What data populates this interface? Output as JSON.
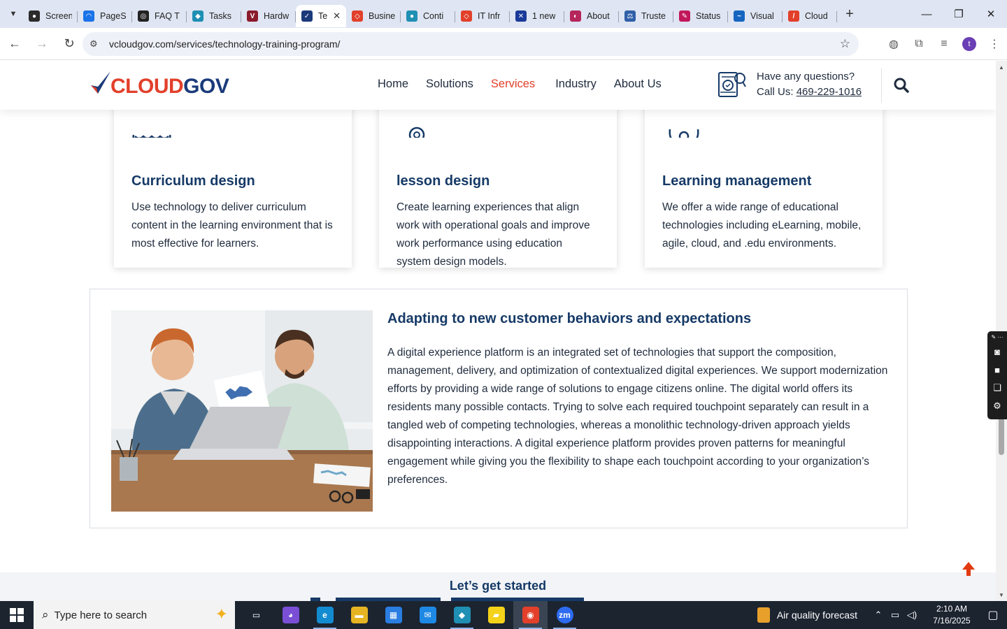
{
  "browser": {
    "tabs": [
      {
        "title": "Screen",
        "fav_color": "#2b2b2b",
        "fav_glyph": "●"
      },
      {
        "title": "PageS",
        "fav_color": "#1a73e8",
        "fav_glyph": "◠"
      },
      {
        "title": "FAQ T",
        "fav_color": "#222222",
        "fav_glyph": "◎"
      },
      {
        "title": "Tasks",
        "fav_color": "#1f8fb3",
        "fav_glyph": "◆"
      },
      {
        "title": "Hardw",
        "fav_color": "#8b1a2b",
        "fav_glyph": "V"
      },
      {
        "title": "Te",
        "fav_color": "#1a3a7a",
        "fav_glyph": "✓",
        "active": true
      },
      {
        "title": "Busine",
        "fav_color": "#e2402b",
        "fav_glyph": "◇"
      },
      {
        "title": "Conti",
        "fav_color": "#1f8fb3",
        "fav_glyph": "●"
      },
      {
        "title": "IT Infr",
        "fav_color": "#e2402b",
        "fav_glyph": "◇"
      },
      {
        "title": "1 new",
        "fav_color": "#1a3a9a",
        "fav_glyph": "✕"
      },
      {
        "title": "About",
        "fav_color": "#b5265a",
        "fav_glyph": "◐"
      },
      {
        "title": "Truste",
        "fav_color": "#2f5fa8",
        "fav_glyph": "⚖"
      },
      {
        "title": "Status",
        "fav_color": "#c2185b",
        "fav_glyph": "✎"
      },
      {
        "title": "Visual",
        "fav_color": "#1565c0",
        "fav_glyph": "~"
      },
      {
        "title": "Cloud",
        "fav_color": "#e2402b",
        "fav_glyph": "/"
      }
    ],
    "url": "vcloudgov.com/services/technology-training-program/",
    "profile_initial": "t"
  },
  "site": {
    "logo": {
      "part1": "CLOUD",
      "part2": "GOV"
    },
    "nav": [
      {
        "label": "Home",
        "current": false
      },
      {
        "label": "Solutions",
        "current": false
      },
      {
        "label": "Services",
        "current": true
      },
      {
        "label": "Industry",
        "current": false
      },
      {
        "label": "About Us",
        "current": false
      }
    ],
    "contact": {
      "question": "Have any questions?",
      "call_prefix": "Call Us: ",
      "phone": "469-229-1016"
    },
    "accent": "#e2402b",
    "heading_color": "#163a67"
  },
  "cards": [
    {
      "title": "Curriculum design",
      "text": "Use technology to deliver curriculum content in the learning environment that is most effective for learners.",
      "icon": "cloud-icon"
    },
    {
      "title": "lesson design",
      "text": "Create learning experiences that align work with operational goals and improve work performance using education system design models.",
      "icon": "gear-head-icon"
    },
    {
      "title": "Learning management",
      "text": "We offer a wide range of educational technologies including eLearning, mobile, agile, cloud, and .edu environments.",
      "icon": "brain-gear-icon"
    }
  ],
  "feature": {
    "title": "Adapting to new customer behaviors and expectations",
    "text": "A digital experience platform is an integrated set of technologies that support the composition, management, delivery, and optimization of contextualized digital experiences. We support modernization efforts by providing a wide range of solutions to engage citizens online. The digital world offers its residents many possible contacts. Trying to solve each required touchpoint separately can result in a tangled web of competing technologies, whereas a monolithic technology-driven approach yields disappointing interactions. A digital experience platform provides proven patterns for meaningful engagement while giving you the flexibility to shape each touchpoint according to your organization’s preferences."
  },
  "bottom": {
    "lead": "Let’s get started"
  },
  "taskbar": {
    "search_placeholder": "Type here to search",
    "weather": "Air quality forecast",
    "time": "2:10 AM",
    "date": "7/16/2025",
    "apps": [
      {
        "name": "task-view",
        "color": "#1c2430",
        "glyph": "▭"
      },
      {
        "name": "copilot",
        "color": "#7a4fd6",
        "glyph": "◕"
      },
      {
        "name": "edge",
        "color": "#138bd1",
        "glyph": "e"
      },
      {
        "name": "file-explorer",
        "color": "#e6b422",
        "glyph": "▬"
      },
      {
        "name": "store",
        "color": "#2a7de1",
        "glyph": "▦"
      },
      {
        "name": "mail",
        "color": "#1e88e5",
        "glyph": "✉"
      },
      {
        "name": "app-diamond",
        "color": "#1f8fb3",
        "glyph": "◆"
      },
      {
        "name": "sticky-notes",
        "color": "#f4d21a",
        "glyph": "▰"
      },
      {
        "name": "chrome",
        "color": "#e2402b",
        "glyph": "◉"
      },
      {
        "name": "zoom",
        "color": "#2d6cf0",
        "glyph": "zm"
      }
    ]
  }
}
